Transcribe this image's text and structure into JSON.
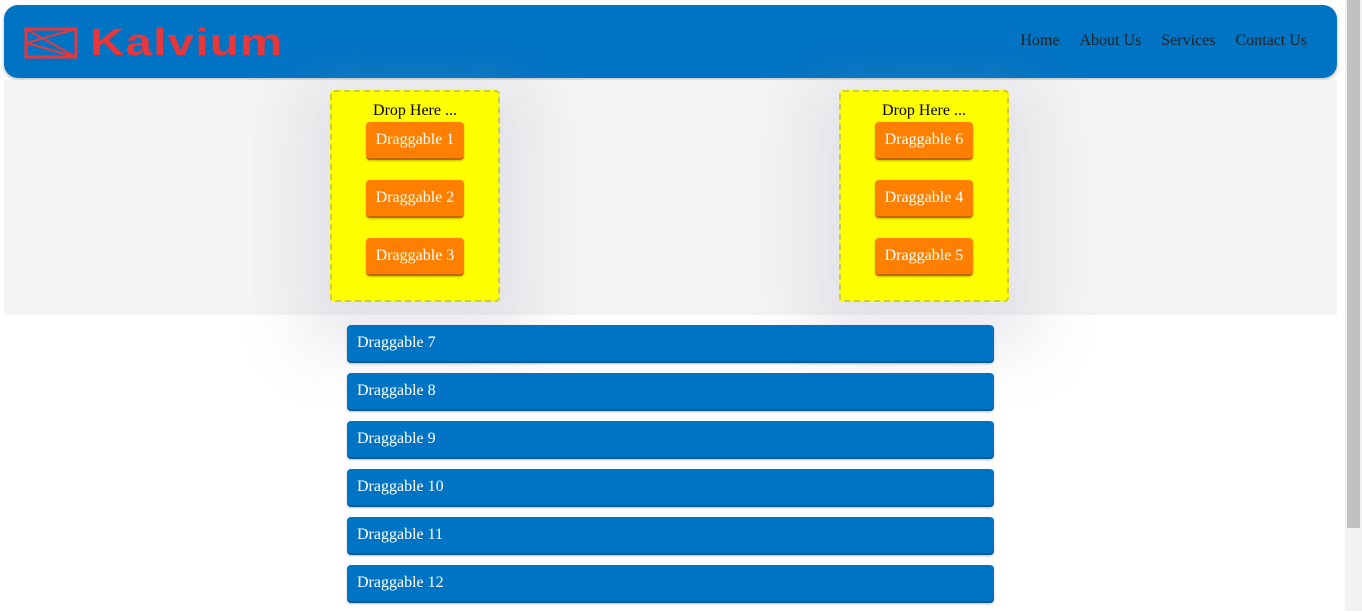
{
  "header": {
    "logo_text": "Kalvium",
    "nav": [
      "Home",
      "About Us",
      "Services",
      "Contact Us"
    ]
  },
  "drop_zones": [
    {
      "title": "Drop Here ...",
      "items": [
        "Draggable 1",
        "Draggable 2",
        "Draggable 3"
      ]
    },
    {
      "title": "Drop Here ...",
      "items": [
        "Draggable 6",
        "Draggable 4",
        "Draggable 5"
      ]
    }
  ],
  "list": [
    "Draggable 7",
    "Draggable 8",
    "Draggable 9",
    "Draggable 10",
    "Draggable 11",
    "Draggable 12"
  ],
  "colors": {
    "header": "#0074c4",
    "logo": "#e8373b",
    "drop_zone": "#ffff00",
    "chip": "#ff8000",
    "bar": "#0074c4"
  },
  "icons": {
    "logo": "kalvium-logo-icon"
  }
}
